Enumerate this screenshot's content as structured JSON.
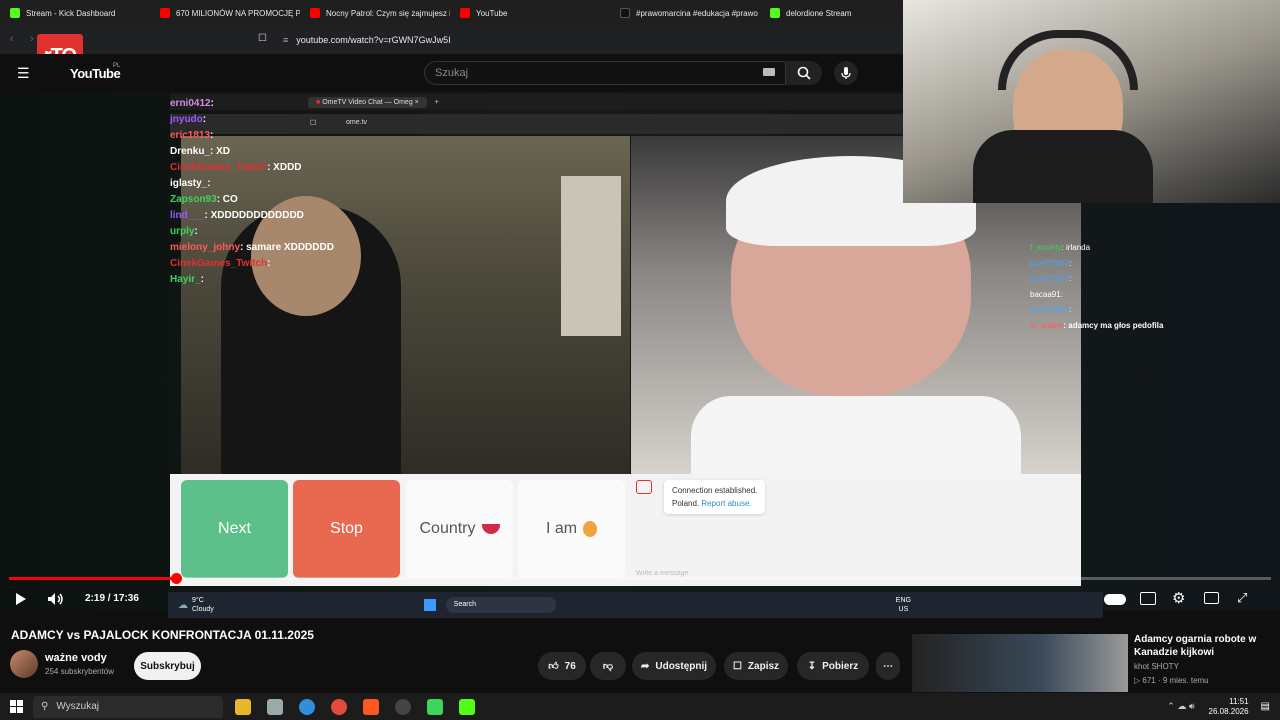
{
  "browser": {
    "tabs": [
      {
        "label": "Stream - Kick Dashboard",
        "color": "#53fc18"
      },
      {
        "label": "670 MILIONÓW NA PROMOCJĘ PO",
        "color": "#ff0000"
      },
      {
        "label": "Nocny Patrol: Czym się zajmujesz i",
        "color": "#ff0000"
      },
      {
        "label": "YouTube",
        "color": "#ff0000"
      },
      {
        "label": "#prawomarcina #edukacja #prawo",
        "color": "#000000"
      },
      {
        "label": "delordione Stream",
        "color": "#53fc18"
      }
    ],
    "url": "youtube.com/watch?v=rGWN7GwJw5I"
  },
  "youtube": {
    "logo": "YouTube",
    "region": "PL",
    "search_placeholder": "Szukaj"
  },
  "inner_browser": {
    "tab_label": "OmeTV Video Chat — Omeg",
    "url": "ome.tv"
  },
  "stream_chat": [
    {
      "user": "erni0412",
      "msg": ":"
    },
    {
      "user": "jnyudo",
      "msg": ":"
    },
    {
      "user": "eric1813",
      "msg": ":"
    },
    {
      "user": "Drenku_",
      "msg": ": XD"
    },
    {
      "user": "CinekGames_Twitch",
      "msg": ": XDDD"
    },
    {
      "user": "iglasty_",
      "msg": ":"
    },
    {
      "user": "Zapson93",
      "msg": ": CO"
    },
    {
      "user": "lind___",
      "msg": ": XDDDDDDDDDDDD"
    },
    {
      "user": "urply",
      "msg": ":"
    },
    {
      "user": "mielony_johny",
      "msg": ": samare XDDDDDD"
    },
    {
      "user": "CinekGames_Twitch",
      "msg": ":"
    },
    {
      "user": "Hayir_",
      "msg": ":"
    }
  ],
  "side_chat": [
    {
      "user": "f_society",
      "msg": ": irlanda"
    },
    {
      "user": "jozef71307",
      "msg": ":"
    },
    {
      "user": "jozef71307",
      "msg": ":"
    },
    {
      "user": "bacaa91",
      "msg": ":"
    },
    {
      "user": "jozef71307",
      "msg": ":"
    },
    {
      "user": "fx_ombre",
      "msg": ": adamcy ma głos pedofila"
    }
  ],
  "ometv": {
    "next": "Next",
    "stop": "Stop",
    "country": "Country",
    "iam": "I am",
    "status": "Connection established.",
    "country_name": "Poland.",
    "report": "Report abuse.",
    "message_placeholder": "Write a message"
  },
  "inner_taskbar": {
    "weather_temp": "9°C",
    "weather_desc": "Cloudy",
    "search": "Search",
    "lang1": "ENG",
    "lang2": "US"
  },
  "player": {
    "time": "2:19 / 17:36",
    "progress": 0.132
  },
  "video": {
    "title": "ADAMCY vs PAJALOCK KONFRONTACJA 01.11.2025",
    "channel": "ważne vody",
    "subscribers": "254 subskrybentów",
    "subscribe": "Subskrybuj",
    "likes": "76",
    "share": "Udostępnij",
    "save": "Zapisz",
    "download": "Pobierz"
  },
  "recommended": {
    "title": "Adamcy ogarnia robote w Kanadzie kijkowi",
    "channel": "khot SHOTY",
    "meta": "671 · 9 mies. temu"
  },
  "taskbar": {
    "search": "Wyszukaj",
    "time": "11:51",
    "date": "26.08.2026"
  },
  "logo_overlay": "rTO"
}
